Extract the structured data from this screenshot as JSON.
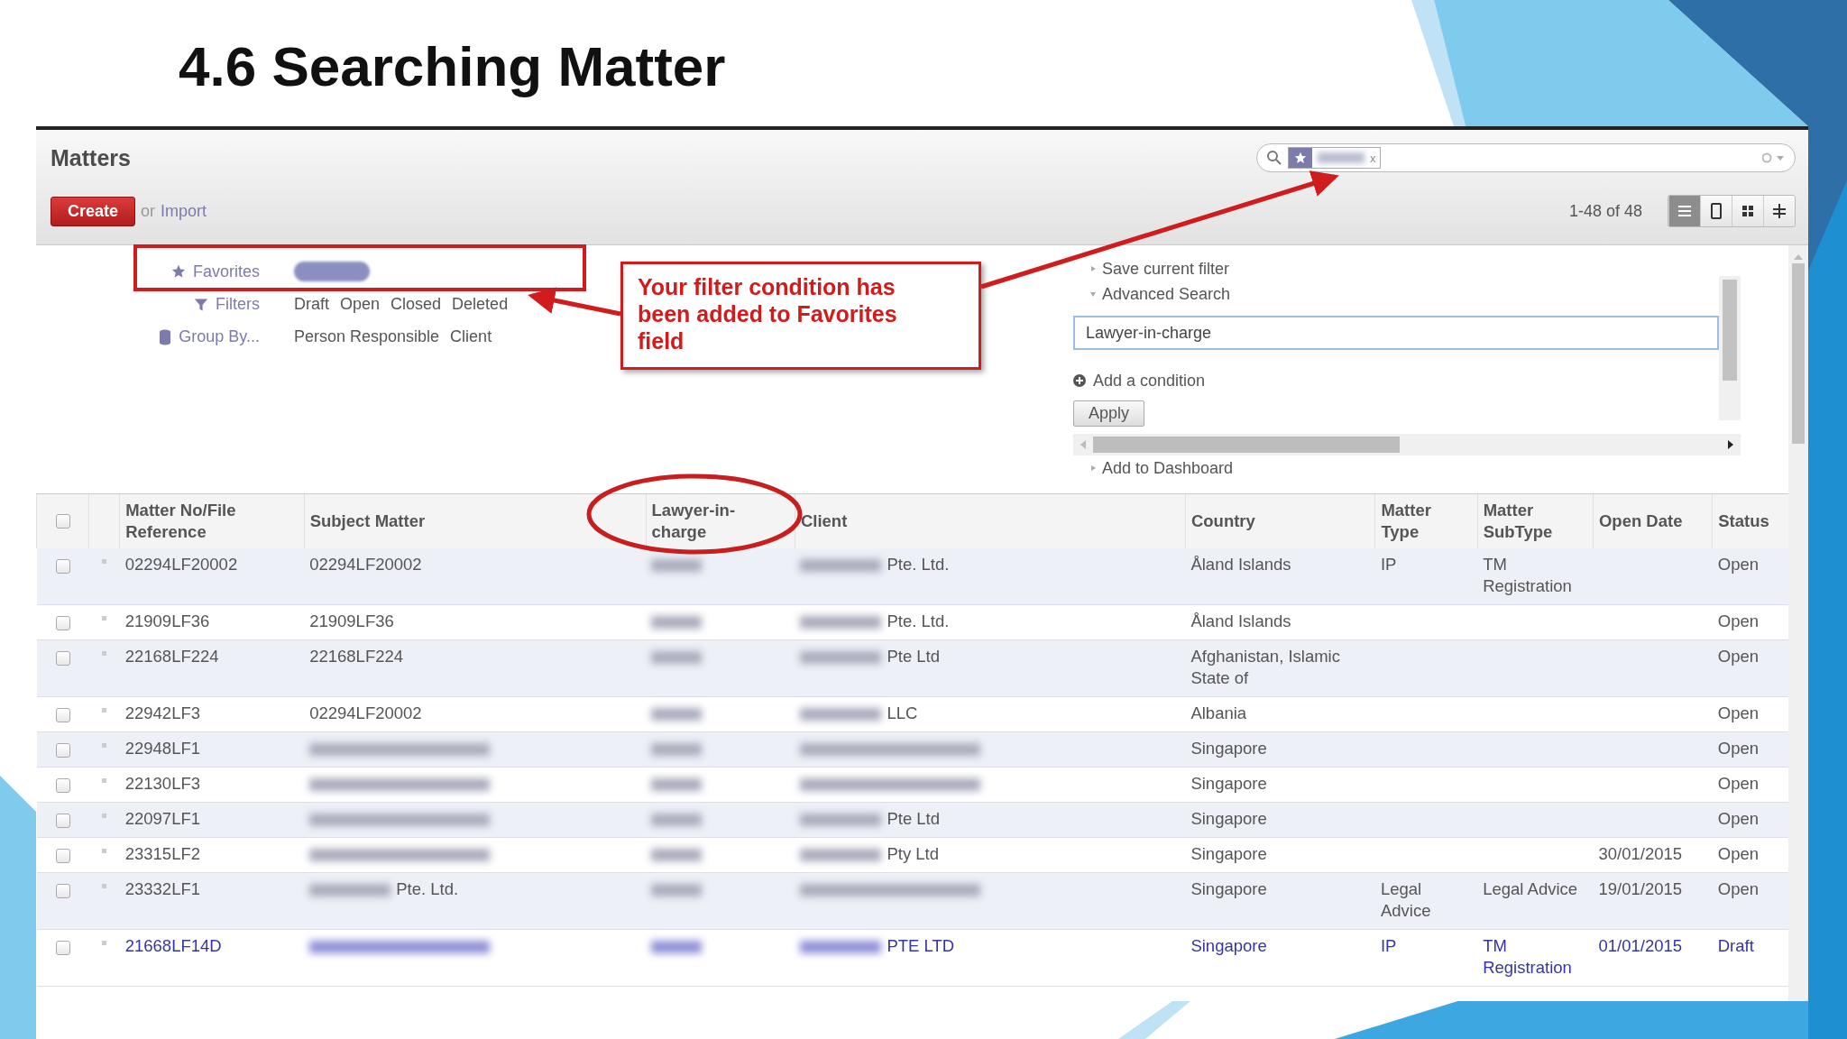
{
  "slide": {
    "title": "4.6 Searching Matter"
  },
  "app": {
    "title": "Matters",
    "create": "Create",
    "or": "or",
    "import": "Import",
    "search": {
      "facet_close": "x"
    },
    "pager": "1-48 of 48",
    "views": [
      {
        "kind": "list",
        "selected": true
      },
      {
        "kind": "form",
        "selected": false
      },
      {
        "kind": "kanban",
        "selected": false
      },
      {
        "kind": "gantt",
        "selected": false
      }
    ],
    "drawer": {
      "favorites": {
        "label": "Favorites"
      },
      "filters": {
        "label": "Filters",
        "options": [
          "Draft",
          "Open",
          "Closed",
          "Deleted"
        ]
      },
      "group_by": {
        "label": "Group By...",
        "options": [
          "Person Responsible",
          "Client"
        ]
      },
      "save_filter": "Save current filter",
      "advanced_search": "Advanced Search",
      "field_value": "Lawyer-in-charge",
      "add_condition": "Add a condition",
      "apply": "Apply",
      "add_to_dashboard": "Add to Dashboard"
    },
    "table": {
      "select_all": {
        "checked": false
      },
      "columns": [
        "Matter No/File Reference",
        "Subject Matter",
        "Lawyer-in-charge",
        "Client",
        "Country",
        "Matter Type",
        "Matter SubType",
        "Open Date",
        "Status"
      ],
      "rows": [
        {
          "kind": "open",
          "checked": false,
          "matter_no": "02294LF20002",
          "subject": {
            "text": "02294LF20002",
            "redacted": false
          },
          "client": {
            "text": "Pte. Ltd.",
            "redacted": true
          },
          "country": "Åland Islands",
          "matter_type": "IP",
          "subtype": "TM Registration",
          "status": "Open"
        },
        {
          "kind": "open",
          "checked": false,
          "matter_no": "21909LF36",
          "subject": {
            "text": "21909LF36",
            "redacted": false
          },
          "client": {
            "text": "Pte. Ltd.",
            "redacted": true
          },
          "country": "Åland Islands",
          "status": "Open"
        },
        {
          "kind": "open",
          "checked": false,
          "matter_no": "22168LF224",
          "subject": {
            "text": "22168LF224",
            "redacted": false
          },
          "client": {
            "text": "Pte Ltd",
            "redacted": true
          },
          "country": "Afghanistan, Islamic State of",
          "status": "Open"
        },
        {
          "kind": "open",
          "checked": false,
          "matter_no": "22942LF3",
          "subject": {
            "text": "02294LF20002",
            "redacted": false
          },
          "client": {
            "text": "LLC",
            "redacted": true
          },
          "country": "Albania",
          "status": "Open"
        },
        {
          "kind": "open",
          "checked": false,
          "matter_no": "22948LF1",
          "subject": {
            "redacted": true
          },
          "client": {
            "redacted": true
          },
          "country": "Singapore",
          "status": "Open"
        },
        {
          "kind": "open",
          "checked": false,
          "matter_no": "22130LF3",
          "subject": {
            "redacted": true
          },
          "client": {
            "redacted": true
          },
          "country": "Singapore",
          "status": "Open"
        },
        {
          "kind": "open",
          "checked": false,
          "matter_no": "22097LF1",
          "subject": {
            "redacted": true
          },
          "client": {
            "text": "Pte Ltd",
            "redacted": true
          },
          "country": "Singapore",
          "status": "Open"
        },
        {
          "kind": "open",
          "checked": false,
          "matter_no": "23315LF2",
          "subject": {
            "redacted": true
          },
          "client": {
            "text": "Pty Ltd",
            "redacted": true
          },
          "country": "Singapore",
          "open_date": "30/01/2015",
          "status": "Open"
        },
        {
          "kind": "open",
          "checked": false,
          "matter_no": "23332LF1",
          "subject": {
            "text": "Pte. Ltd.",
            "redacted": true
          },
          "client": {
            "redacted": true
          },
          "country": "Singapore",
          "matter_type": "Legal Advice",
          "subtype": "Legal Advice",
          "open_date": "19/01/2015",
          "status": "Open"
        },
        {
          "kind": "draft",
          "checked": false,
          "matter_no": "21668LF14D",
          "subject": {
            "redacted": true
          },
          "client": {
            "text": "PTE LTD",
            "redacted": true
          },
          "country": "Singapore",
          "matter_type": "IP",
          "subtype": "TM Registration",
          "open_date": "01/01/2015",
          "status": "Draft"
        }
      ]
    }
  },
  "annotations": {
    "callout": "Your filter condition has been added to Favorites field"
  }
}
